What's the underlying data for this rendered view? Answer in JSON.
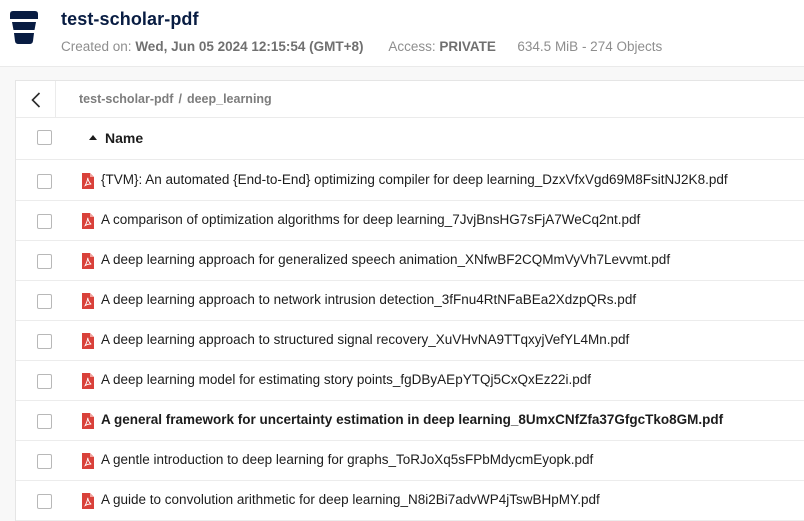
{
  "bucket": {
    "name": "test-scholar-pdf",
    "created_label": "Created on:",
    "created_value": "Wed, Jun 05 2024 12:15:54 (GMT+8)",
    "access_label": "Access:",
    "access_value": "PRIVATE",
    "usage": "634.5 MiB - 274 Objects"
  },
  "breadcrumb": {
    "root": "test-scholar-pdf",
    "separator": "/",
    "current": "deep_learning"
  },
  "table": {
    "column_name": "Name",
    "sort": "ascending",
    "files": [
      {
        "name": "{TVM}: An automated {End-to-End} optimizing compiler for deep learning_DzxVfxVgd69M8FsitNJ2K8.pdf",
        "highlighted": false
      },
      {
        "name": "A comparison of optimization algorithms for deep learning_7JvjBnsHG7sFjA7WeCq2nt.pdf",
        "highlighted": false
      },
      {
        "name": "A deep learning approach for generalized speech animation_XNfwBF2CQMmVyVh7Levvmt.pdf",
        "highlighted": false
      },
      {
        "name": "A deep learning approach to network intrusion detection_3fFnu4RtNFaBEa2XdzpQRs.pdf",
        "highlighted": false
      },
      {
        "name": "A deep learning approach to structured signal recovery_XuVHvNA9TTqxyjVefYL4Mn.pdf",
        "highlighted": false
      },
      {
        "name": "A deep learning model for estimating story points_fgDByAEpYTQj5CxQxEz22i.pdf",
        "highlighted": false
      },
      {
        "name": "A general framework for uncertainty estimation in deep learning_8UmxCNfZfa37GfgcTko8GM.pdf",
        "highlighted": true
      },
      {
        "name": "A gentle introduction to deep learning for graphs_ToRJoXq5sFPbMdycmEyopk.pdf",
        "highlighted": false
      },
      {
        "name": "A guide to convolution arithmetic for deep learning_N8i2Bi7advWP4jTswBHpMY.pdf",
        "highlighted": false
      }
    ]
  },
  "colors": {
    "brand_navy": "#081c42",
    "pdf_red": "#d9413a"
  },
  "icons": {
    "bucket": "bucket-icon",
    "back": "chevron-left-icon",
    "sort": "sort-ascending-icon",
    "file": "pdf-file-icon"
  }
}
